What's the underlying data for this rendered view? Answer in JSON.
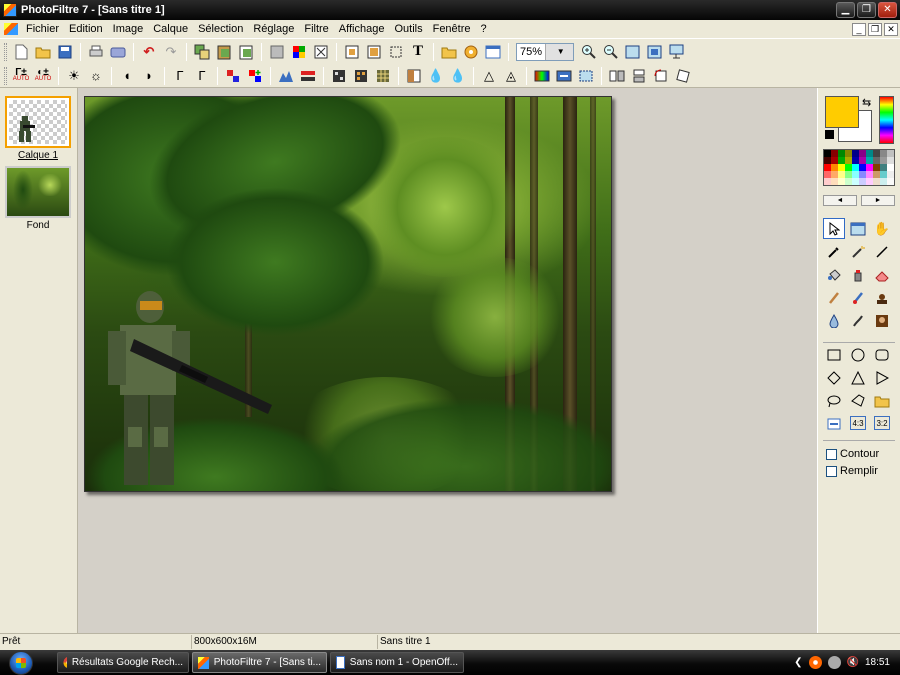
{
  "window": {
    "title": "PhotoFiltre 7 - [Sans titre 1]"
  },
  "menu": [
    "Fichier",
    "Edition",
    "Image",
    "Calque",
    "Sélection",
    "Réglage",
    "Filtre",
    "Affichage",
    "Outils",
    "Fenêtre",
    "?"
  ],
  "toolbar": {
    "zoom_value": "75%",
    "auto_label": "AUTO",
    "text_tool_glyph": "T"
  },
  "layers": [
    {
      "label": "Calque 1",
      "selected": true
    },
    {
      "label": "Fond",
      "selected": false
    }
  ],
  "tools": {
    "fg_color": "#ffcc00",
    "bg_color": "#ffffff",
    "ratio_labels": [
      "4:3",
      "3:2"
    ],
    "contour_label": "Contour",
    "remplir_label": "Remplir"
  },
  "status": {
    "ready": "Prêt",
    "dimensions": "800x600x16M",
    "doc_name": "Sans titre 1"
  },
  "taskbar": {
    "items": [
      {
        "label": "Résultats Google Rech...",
        "icon": "chrome-icon"
      },
      {
        "label": "PhotoFiltre 7 - [Sans ti...",
        "icon": "photofiltre-icon"
      },
      {
        "label": "Sans nom 1 - OpenOff...",
        "icon": "openoffice-icon"
      }
    ],
    "clock": "18:51"
  }
}
